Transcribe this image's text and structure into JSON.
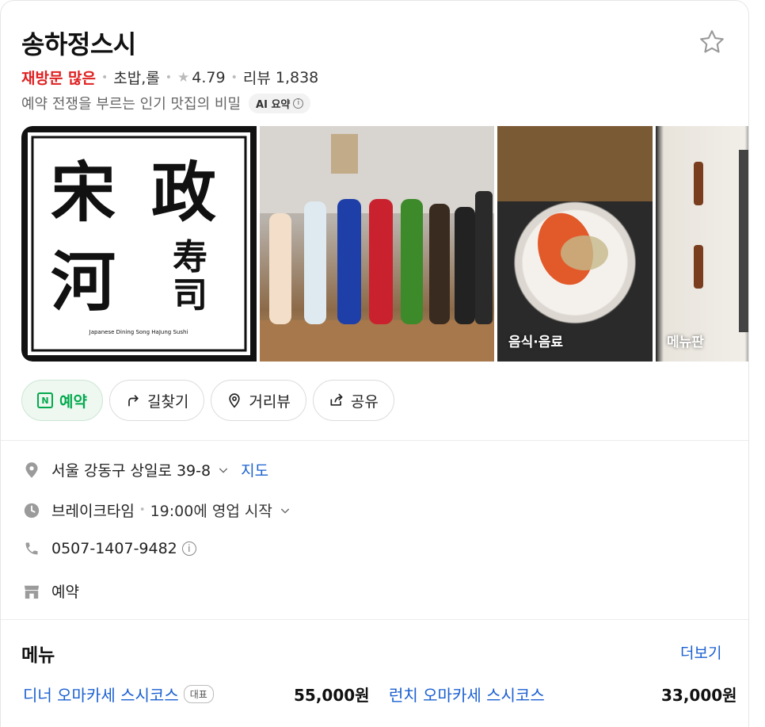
{
  "place": {
    "name": "송하정스시",
    "tag_hot": "재방문 많은",
    "category": "초밥,롤",
    "rating": "4.79",
    "review_label": "리뷰",
    "review_count": "1,838",
    "ai_summary": "예약 전쟁을 부르는 인기 맛집의 비밀",
    "ai_badge": "AI 요약"
  },
  "photos": [
    {
      "label": ""
    },
    {
      "label": ""
    },
    {
      "label": "음식·음료"
    },
    {
      "label": "메뉴판"
    }
  ],
  "logo": {
    "chars": [
      "宋",
      "政",
      "河",
      "寿",
      "司"
    ],
    "subtitle": "Japanese Dining Song HaJung Sushi"
  },
  "actions": {
    "reserve": "예약",
    "directions": "길찾기",
    "streetview": "거리뷰",
    "share": "공유"
  },
  "info": {
    "address": "서울 강동구 상일로 39-8",
    "map_link": "지도",
    "status": "브레이크타임",
    "status_detail": "19:00에 영업 시작",
    "phone": "0507-1407-9482",
    "amenity": "예약"
  },
  "menu": {
    "heading": "메뉴",
    "more": "더보기",
    "items": [
      {
        "name": "디너 오마카세 스시코스",
        "badge": "대표",
        "price": "55,000원"
      },
      {
        "name": "런치 오마카세 스시코스",
        "badge": "",
        "price": "33,000원"
      }
    ]
  },
  "colors": {
    "accent_green": "#03a94d",
    "link_blue": "#1a60d1",
    "hot_red": "#e02020"
  }
}
